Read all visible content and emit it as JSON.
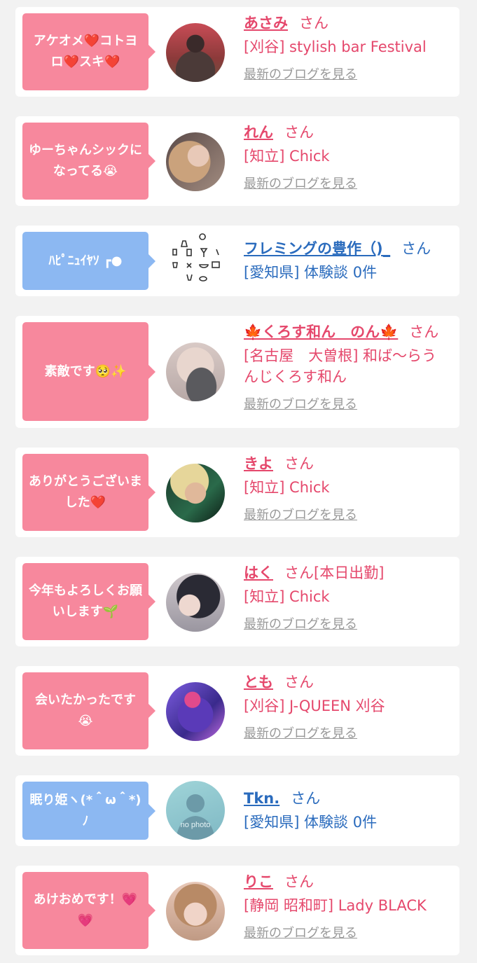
{
  "colors": {
    "pink_bubble": "#f7889d",
    "blue_bubble": "#8cb8f2",
    "pink_text": "#e5486c",
    "blue_text": "#2a6bbd",
    "link_gray": "#999999"
  },
  "honorific": "さん",
  "blog_link": "最新のブログを見る",
  "items": [
    {
      "bubble_color": "pink",
      "message": "アケオメ❤️コトヨロ❤️スキ❤️",
      "avatar_icon": "avatar-photo",
      "name": "あさみ",
      "name_color": "pink",
      "suffix": "",
      "shop": "[刈谷] stylish bar Festival",
      "has_blog": true
    },
    {
      "bubble_color": "pink",
      "message": "ゆーちゃんシックになってる😭",
      "avatar_icon": "avatar-photo",
      "name": "れん",
      "name_color": "pink",
      "suffix": "",
      "shop": "[知立] Chick",
      "has_blog": true
    },
    {
      "bubble_color": "blue",
      "message": "ﾊﾋﾟﾆｭｲﾔｿ ┏●",
      "avatar_icon": "avatar-drawing",
      "name": "フレミングの豊作（)_",
      "name_color": "blue",
      "suffix": "",
      "shop": "[愛知県] 体験談 0件",
      "has_blog": false
    },
    {
      "bubble_color": "pink",
      "message": "素敵です🥺✨",
      "avatar_icon": "avatar-photo",
      "name": "🍁くろす和ん　のん🍁",
      "name_color": "pink",
      "suffix": "",
      "shop": "[名古屋　大曽根] 和ば〜らうんじくろす和ん",
      "has_blog": true
    },
    {
      "bubble_color": "pink",
      "message": "ありがとうございました❤️",
      "avatar_icon": "avatar-photo",
      "name": "きよ",
      "name_color": "pink",
      "suffix": "",
      "shop": "[知立] Chick",
      "has_blog": true
    },
    {
      "bubble_color": "pink",
      "message": "今年もよろしくお願いします🌱",
      "avatar_icon": "avatar-photo",
      "name": "はく",
      "name_color": "pink",
      "suffix": "[本日出勤]",
      "shop": "[知立] Chick",
      "has_blog": true
    },
    {
      "bubble_color": "pink",
      "message": "会いたかったです😭",
      "avatar_icon": "avatar-photo",
      "name": "とも",
      "name_color": "pink",
      "suffix": "",
      "shop": "[刈谷] J-QUEEN 刈谷",
      "has_blog": true
    },
    {
      "bubble_color": "blue",
      "message": "眠り姫ヽ(*＾ω＾*)ﾉ",
      "avatar_icon": "avatar-no-photo",
      "avatar_text": "no photo",
      "name": "Tkn.",
      "name_color": "blue",
      "suffix": "",
      "shop": "[愛知県] 体験談 0件",
      "has_blog": false
    },
    {
      "bubble_color": "pink",
      "message": "あけおめです！💗💗",
      "avatar_icon": "avatar-photo",
      "name": "りこ",
      "name_color": "pink",
      "suffix": "",
      "shop": "[静岡 昭和町] Lady BLACK",
      "has_blog": true
    }
  ]
}
